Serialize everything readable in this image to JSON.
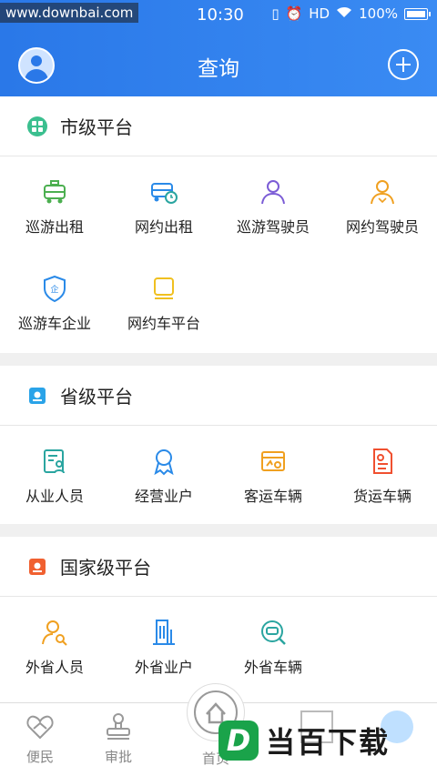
{
  "status": {
    "watermark": "www.downbai.com",
    "time": "10:30",
    "hd": "HD",
    "battery": "100%"
  },
  "header": {
    "title": "查询"
  },
  "sections": [
    {
      "title": "市级平台",
      "items": [
        "巡游出租",
        "网约出租",
        "巡游驾驶员",
        "网约驾驶员",
        "巡游车企业",
        "网约车平台"
      ]
    },
    {
      "title": "省级平台",
      "items": [
        "从业人员",
        "经营业户",
        "客运车辆",
        "货运车辆"
      ]
    },
    {
      "title": "国家级平台",
      "items": [
        "外省人员",
        "外省业户",
        "外省车辆"
      ]
    }
  ],
  "tabs": {
    "t1": "便民",
    "t2": "审批",
    "t3": "首页"
  },
  "logo": {
    "letter": "D",
    "text": "当百下载"
  },
  "colors": {
    "primary": "#2a78e8",
    "green": "#4caf50",
    "teal": "#2aa5a0",
    "purple": "#7b5cd6",
    "orange": "#f0a020",
    "blue": "#2a8ae8",
    "yellow": "#f0c020",
    "red": "#f05030"
  }
}
